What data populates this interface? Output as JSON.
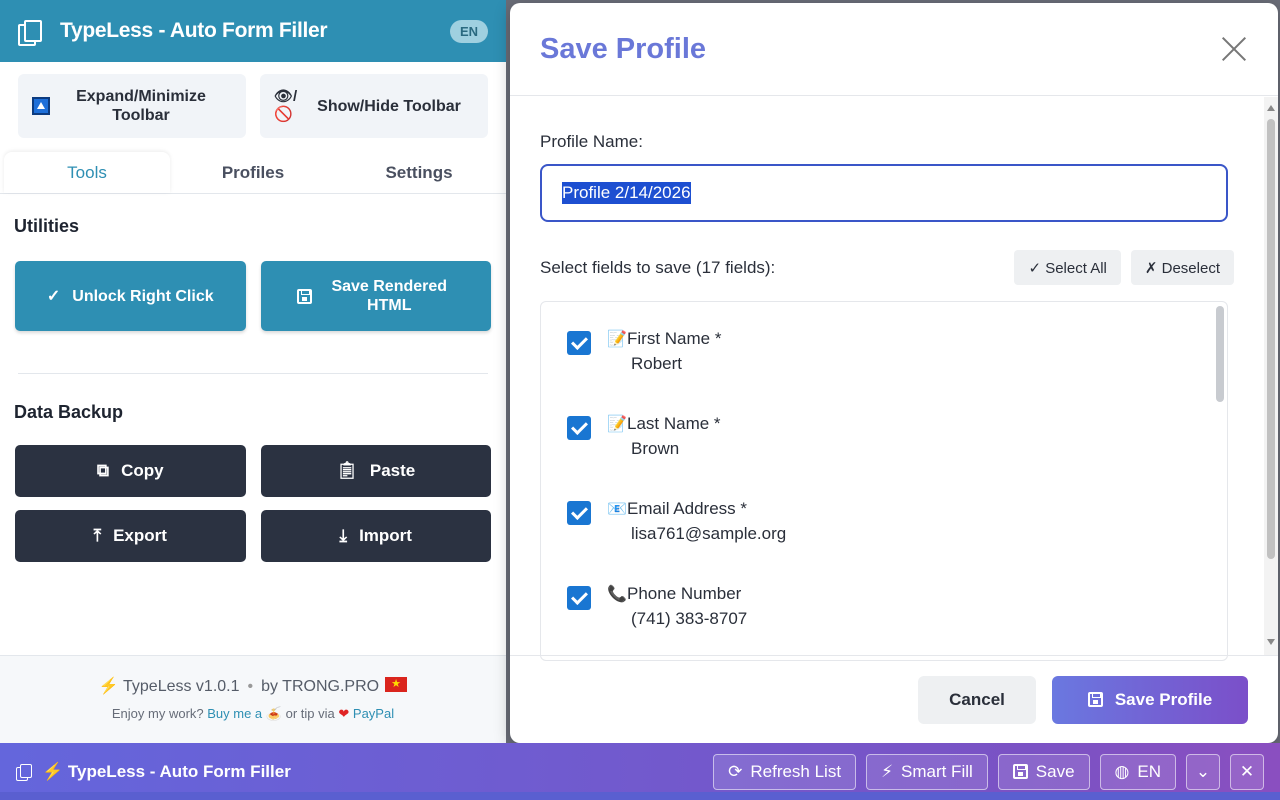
{
  "extension": {
    "title": "TypeLess - Auto Form Filler",
    "lang": "EN",
    "toolbar": {
      "expand_label": "Expand/Minimize Toolbar",
      "showhide_icon_text": "👁/🚫",
      "showhide_label": "Show/Hide Toolbar"
    },
    "tabs": [
      "Tools",
      "Profiles",
      "Settings"
    ],
    "utilities": {
      "title": "Utilities",
      "unlock_label": "Unlock Right Click",
      "save_html_label": "Save Rendered HTML"
    },
    "backup": {
      "title": "Data Backup",
      "copy": "Copy",
      "paste": "Paste",
      "export": "Export",
      "import": "Import"
    },
    "footer": {
      "product": "⚡ TypeLess v1.0.1",
      "author": "by TRONG.PRO",
      "tip_prefix": "Enjoy my work?",
      "buy_me": "Buy me a",
      "coffee": "🍝",
      "tip_via": "or tip via",
      "heart": "❤",
      "paypal": "PayPal"
    }
  },
  "modal": {
    "title": "Save Profile",
    "profile_name_label": "Profile Name:",
    "profile_name_value": "Profile 2/14/2026",
    "fields_label": "Select fields to save (17 fields):",
    "select_all": "✓ Select All",
    "deselect": "✗ Deselect",
    "fields": [
      {
        "icon": "📝",
        "name": "First Name *",
        "value": "Robert"
      },
      {
        "icon": "📝",
        "name": "Last Name *",
        "value": "Brown"
      },
      {
        "icon": "📧",
        "name": "Email Address *",
        "value": "lisa761@sample.org"
      },
      {
        "icon": "📞",
        "name": "Phone Number",
        "value": "(741) 383-8707"
      }
    ],
    "cancel": "Cancel",
    "save": "Save Profile"
  },
  "bottom_bar": {
    "title": "⚡ TypeLess - Auto Form Filler",
    "refresh": "Refresh List",
    "smart_fill": "Smart Fill",
    "save": "Save",
    "lang": "EN"
  },
  "colors": {
    "header_teal": "#2e8fb3",
    "dark_button": "#2b3241",
    "modal_title": "#6a78d8",
    "bar_gradient_start": "#6466dc",
    "bar_gradient_end": "#8a4fc0"
  }
}
